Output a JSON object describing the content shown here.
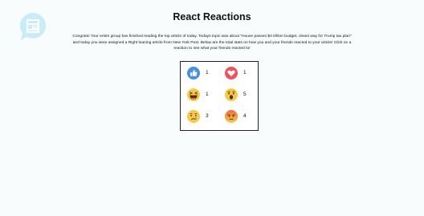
{
  "page": {
    "title": "React Reactions",
    "description": "Congrats! Your entire group has finished reading the top article of today. Todays topic was about \"House passes $4 trillion budget, clears way for Trump tax plan\" and today you were assigned a Right leaning article from New York Post. Below are the total stats on how you and your friends reacted to your article! Click on a reaction to see what your friends reacted to!"
  },
  "logo": {
    "icon": "chat-bubble-article-icon",
    "color": "#c9ecf8"
  },
  "reactions": [
    {
      "name": "like",
      "icon": "like-icon",
      "count": "1",
      "color": "#4a90e2"
    },
    {
      "name": "love",
      "icon": "love-icon",
      "count": "1",
      "color": "#f0515c"
    },
    {
      "name": "haha",
      "icon": "haha-icon",
      "count": "1",
      "color": "#f7c948"
    },
    {
      "name": "wow",
      "icon": "wow-icon",
      "count": "5",
      "color": "#f7c948"
    },
    {
      "name": "sad",
      "icon": "sad-icon",
      "count": "3",
      "color": "#f7c948"
    },
    {
      "name": "angry",
      "icon": "angry-icon",
      "count": "4",
      "color": "#f26b3a"
    }
  ]
}
